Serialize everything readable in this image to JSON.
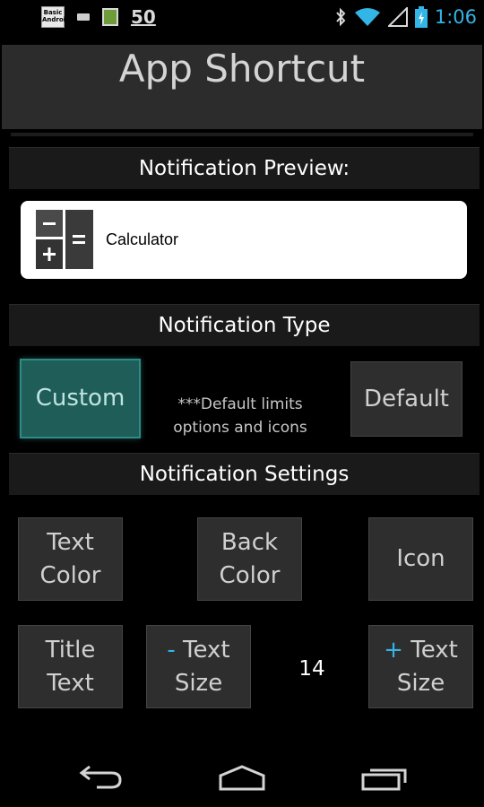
{
  "status_bar": {
    "notification_app": "Basic Android",
    "notification_count": "50",
    "time": "1:06"
  },
  "title_bar": {
    "title": "App Shortcut"
  },
  "sections": {
    "preview_header": "Notification Preview:",
    "type_header": "Notification Type",
    "settings_header": "Notification Settings"
  },
  "preview": {
    "app_name": "Calculator",
    "icon": "calculator-icon"
  },
  "type": {
    "custom_label": "Custom",
    "default_label": "Default",
    "note_line1": "***Default limits",
    "note_line2": "options and icons",
    "selected": "Custom",
    "selected_color": "#1f5d59"
  },
  "settings": {
    "text_color_line1": "Text",
    "text_color_line2": "Color",
    "back_color_line1": "Back",
    "back_color_line2": "Color",
    "icon_label": "Icon",
    "title_text_line1": "Title",
    "title_text_line2": "Text",
    "decrease_symbol": "-",
    "decrease_line1": "Text",
    "decrease_line2": "Size",
    "text_size_value": "14",
    "increase_symbol": "+",
    "increase_line1": "Text",
    "increase_line2": "Size"
  },
  "nav": {
    "back": "back-icon",
    "home": "home-icon",
    "recents": "recents-icon"
  },
  "colors": {
    "accent": "#33b5e5",
    "background": "#000000"
  }
}
